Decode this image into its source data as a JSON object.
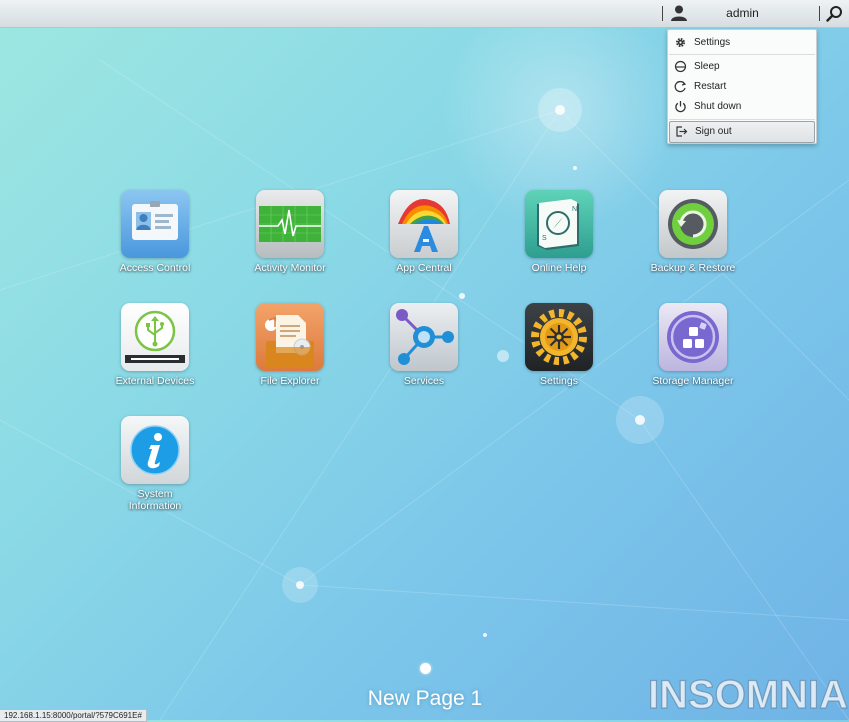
{
  "topbar": {
    "user_name": "admin",
    "icons": [
      "user-icon",
      "search-icon"
    ]
  },
  "user_menu": {
    "items": [
      {
        "label": "Settings",
        "icon": "gear-icon"
      },
      {
        "label": "Sleep",
        "icon": "sleep-icon"
      },
      {
        "label": "Restart",
        "icon": "restart-icon"
      },
      {
        "label": "Shut down",
        "icon": "power-icon"
      },
      {
        "label": "Sign out",
        "icon": "sign-out-icon",
        "highlighted": true
      }
    ]
  },
  "desktop": {
    "apps": [
      {
        "label": "Access Control",
        "icon": "id-badge-icon"
      },
      {
        "label": "Activity Monitor",
        "icon": "heartbeat-monitor-icon"
      },
      {
        "label": "App Central",
        "icon": "app-central-icon"
      },
      {
        "label": "Online Help",
        "icon": "help-book-icon"
      },
      {
        "label": "Backup & Restore",
        "icon": "backup-restore-icon"
      },
      {
        "label": "External Devices",
        "icon": "usb-device-icon"
      },
      {
        "label": "File Explorer",
        "icon": "file-explorer-icon"
      },
      {
        "label": "Services",
        "icon": "services-network-icon"
      },
      {
        "label": "Settings",
        "icon": "gear-settings-icon"
      },
      {
        "label": "Storage Manager",
        "icon": "storage-manager-icon"
      },
      {
        "label": "System\nInformation",
        "icon": "info-icon"
      }
    ],
    "page_name": "New Page 1"
  },
  "status_bar": {
    "url": "192.168.1.15:8000/portal/?579C691E#"
  },
  "watermark": {
    "text": "INSOMNIA"
  },
  "colors": {
    "background_start": "#9ee7e1",
    "background_end": "#6fb3e6",
    "label_text": "#ffffff"
  }
}
